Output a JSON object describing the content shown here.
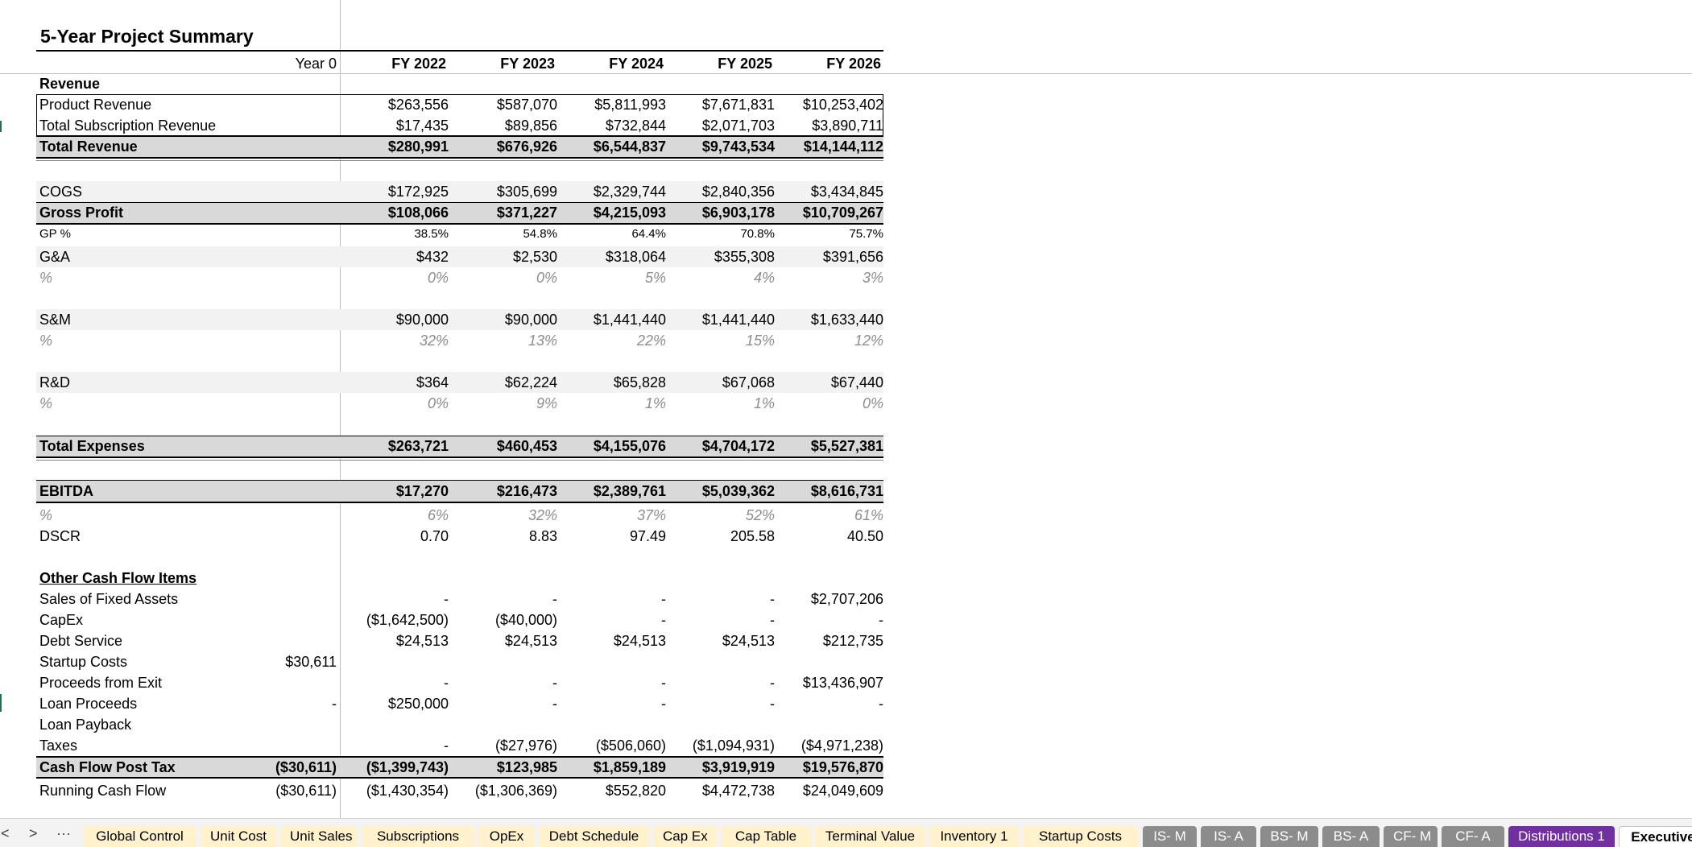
{
  "title": "5-Year Project Summary",
  "headers": [
    "Year 0",
    "FY 2022",
    "FY 2023",
    "FY 2024",
    "FY 2025",
    "FY 2026"
  ],
  "revenue_heading": "Revenue",
  "rows": {
    "product_revenue": {
      "label": "Product Revenue",
      "values": [
        "",
        "$263,556",
        "$587,070",
        "$5,811,993",
        "$7,671,831",
        "$10,253,402"
      ]
    },
    "subscription_revenue": {
      "label": "Total Subscription Revenue",
      "values": [
        "",
        "$17,435",
        "$89,856",
        "$732,844",
        "$2,071,703",
        "$3,890,711"
      ]
    },
    "total_revenue": {
      "label": "Total Revenue",
      "values": [
        "",
        "$280,991",
        "$676,926",
        "$6,544,837",
        "$9,743,534",
        "$14,144,112"
      ]
    },
    "cogs": {
      "label": "COGS",
      "values": [
        "",
        "$172,925",
        "$305,699",
        "$2,329,744",
        "$2,840,356",
        "$3,434,845"
      ]
    },
    "gross_profit": {
      "label": "Gross Profit",
      "values": [
        "",
        "$108,066",
        "$371,227",
        "$4,215,093",
        "$6,903,178",
        "$10,709,267"
      ]
    },
    "gp_pct": {
      "label": "GP %",
      "values": [
        "",
        "38.5%",
        "54.8%",
        "64.4%",
        "70.8%",
        "75.7%"
      ]
    },
    "ga": {
      "label": "G&A",
      "values": [
        "",
        "$432",
        "$2,530",
        "$318,064",
        "$355,308",
        "$391,656"
      ]
    },
    "ga_pct": {
      "label": "%",
      "values": [
        "",
        "0%",
        "0%",
        "5%",
        "4%",
        "3%"
      ]
    },
    "sm": {
      "label": "S&M",
      "values": [
        "",
        "$90,000",
        "$90,000",
        "$1,441,440",
        "$1,441,440",
        "$1,633,440"
      ]
    },
    "sm_pct": {
      "label": "%",
      "values": [
        "",
        "32%",
        "13%",
        "22%",
        "15%",
        "12%"
      ]
    },
    "rd": {
      "label": "R&D",
      "values": [
        "",
        "$364",
        "$62,224",
        "$65,828",
        "$67,068",
        "$67,440"
      ]
    },
    "rd_pct": {
      "label": "%",
      "values": [
        "",
        "0%",
        "9%",
        "1%",
        "1%",
        "0%"
      ]
    },
    "total_expenses": {
      "label": "Total Expenses",
      "values": [
        "",
        "$263,721",
        "$460,453",
        "$4,155,076",
        "$4,704,172",
        "$5,527,381"
      ]
    },
    "ebitda": {
      "label": "EBITDA",
      "values": [
        "",
        "$17,270",
        "$216,473",
        "$2,389,761",
        "$5,039,362",
        "$8,616,731"
      ]
    },
    "ebitda_pct": {
      "label": "%",
      "values": [
        "",
        "6%",
        "32%",
        "37%",
        "52%",
        "61%"
      ]
    },
    "dscr": {
      "label": "DSCR",
      "values": [
        "",
        "0.70",
        "8.83",
        "97.49",
        "205.58",
        "40.50"
      ]
    },
    "other_heading": {
      "label": "Other Cash Flow Items",
      "values": [
        "",
        "",
        "",
        "",
        "",
        ""
      ]
    },
    "sales_fixed_assets": {
      "label": "Sales of Fixed Assets",
      "values": [
        "",
        "-",
        "-",
        "-",
        "-",
        "$2,707,206"
      ]
    },
    "capex": {
      "label": "CapEx",
      "values": [
        "",
        "($1,642,500)",
        "($40,000)",
        "-",
        "-",
        "-"
      ]
    },
    "debt_service": {
      "label": "Debt Service",
      "values": [
        "",
        "$24,513",
        "$24,513",
        "$24,513",
        "$24,513",
        "$212,735"
      ]
    },
    "startup_costs": {
      "label": "Startup Costs",
      "values": [
        "$30,611",
        "",
        "",
        "",
        "",
        ""
      ]
    },
    "proceeds_exit": {
      "label": "Proceeds from Exit",
      "values": [
        "",
        "-",
        "-",
        "-",
        "-",
        "$13,436,907"
      ]
    },
    "loan_proceeds": {
      "label": "Loan Proceeds",
      "values": [
        "-",
        "$250,000",
        "-",
        "-",
        "-",
        "-"
      ]
    },
    "loan_payback": {
      "label": "Loan Payback",
      "values": [
        "",
        "",
        "",
        "",
        "",
        ""
      ]
    },
    "taxes": {
      "label": "Taxes",
      "values": [
        "",
        "-",
        "($27,976)",
        "($506,060)",
        "($1,094,931)",
        "($4,971,238)"
      ]
    },
    "cf_post_tax": {
      "label": "Cash Flow Post Tax",
      "values": [
        "($30,611)",
        "($1,399,743)",
        "$123,985",
        "$1,859,189",
        "$3,919,919",
        "$19,576,870"
      ]
    },
    "running_cf": {
      "label": "Running Cash Flow",
      "values": [
        "($30,611)",
        "($1,430,354)",
        "($1,306,369)",
        "$552,820",
        "$4,472,738",
        "$24,049,609"
      ]
    }
  },
  "tabbar": {
    "nav_prev": "<",
    "nav_next": ">",
    "nav_more": "···",
    "tabs": [
      {
        "label": "Global Control",
        "style": "yellow"
      },
      {
        "label": "Unit Cost",
        "style": "yellow"
      },
      {
        "label": "Unit Sales",
        "style": "yellow"
      },
      {
        "label": "Subscriptions",
        "style": "yellow"
      },
      {
        "label": "OpEx",
        "style": "yellow"
      },
      {
        "label": "Debt Schedule",
        "style": "yellow"
      },
      {
        "label": "Cap Ex",
        "style": "yellow"
      },
      {
        "label": "Cap Table",
        "style": "yellow"
      },
      {
        "label": "Terminal Value",
        "style": "yellow"
      },
      {
        "label": "Inventory 1",
        "style": "yellow"
      },
      {
        "label": "Startup Costs",
        "style": "yellow"
      },
      {
        "label": "IS- M",
        "style": "gray"
      },
      {
        "label": "IS- A",
        "style": "gray"
      },
      {
        "label": "BS- M",
        "style": "gray"
      },
      {
        "label": "BS- A",
        "style": "gray"
      },
      {
        "label": "CF- M",
        "style": "gray"
      },
      {
        "label": "CF- A",
        "style": "gray"
      },
      {
        "label": "Distributions 1",
        "style": "purple"
      },
      {
        "label": "Executive",
        "style": "active"
      }
    ]
  },
  "colors": {
    "band": "#f2f2f2",
    "total": "#d9d9d9",
    "tab_yellow": "#fff2cc",
    "tab_gray": "#8c8c8c",
    "tab_purple": "#7030a0",
    "accent_green": "#217346"
  }
}
